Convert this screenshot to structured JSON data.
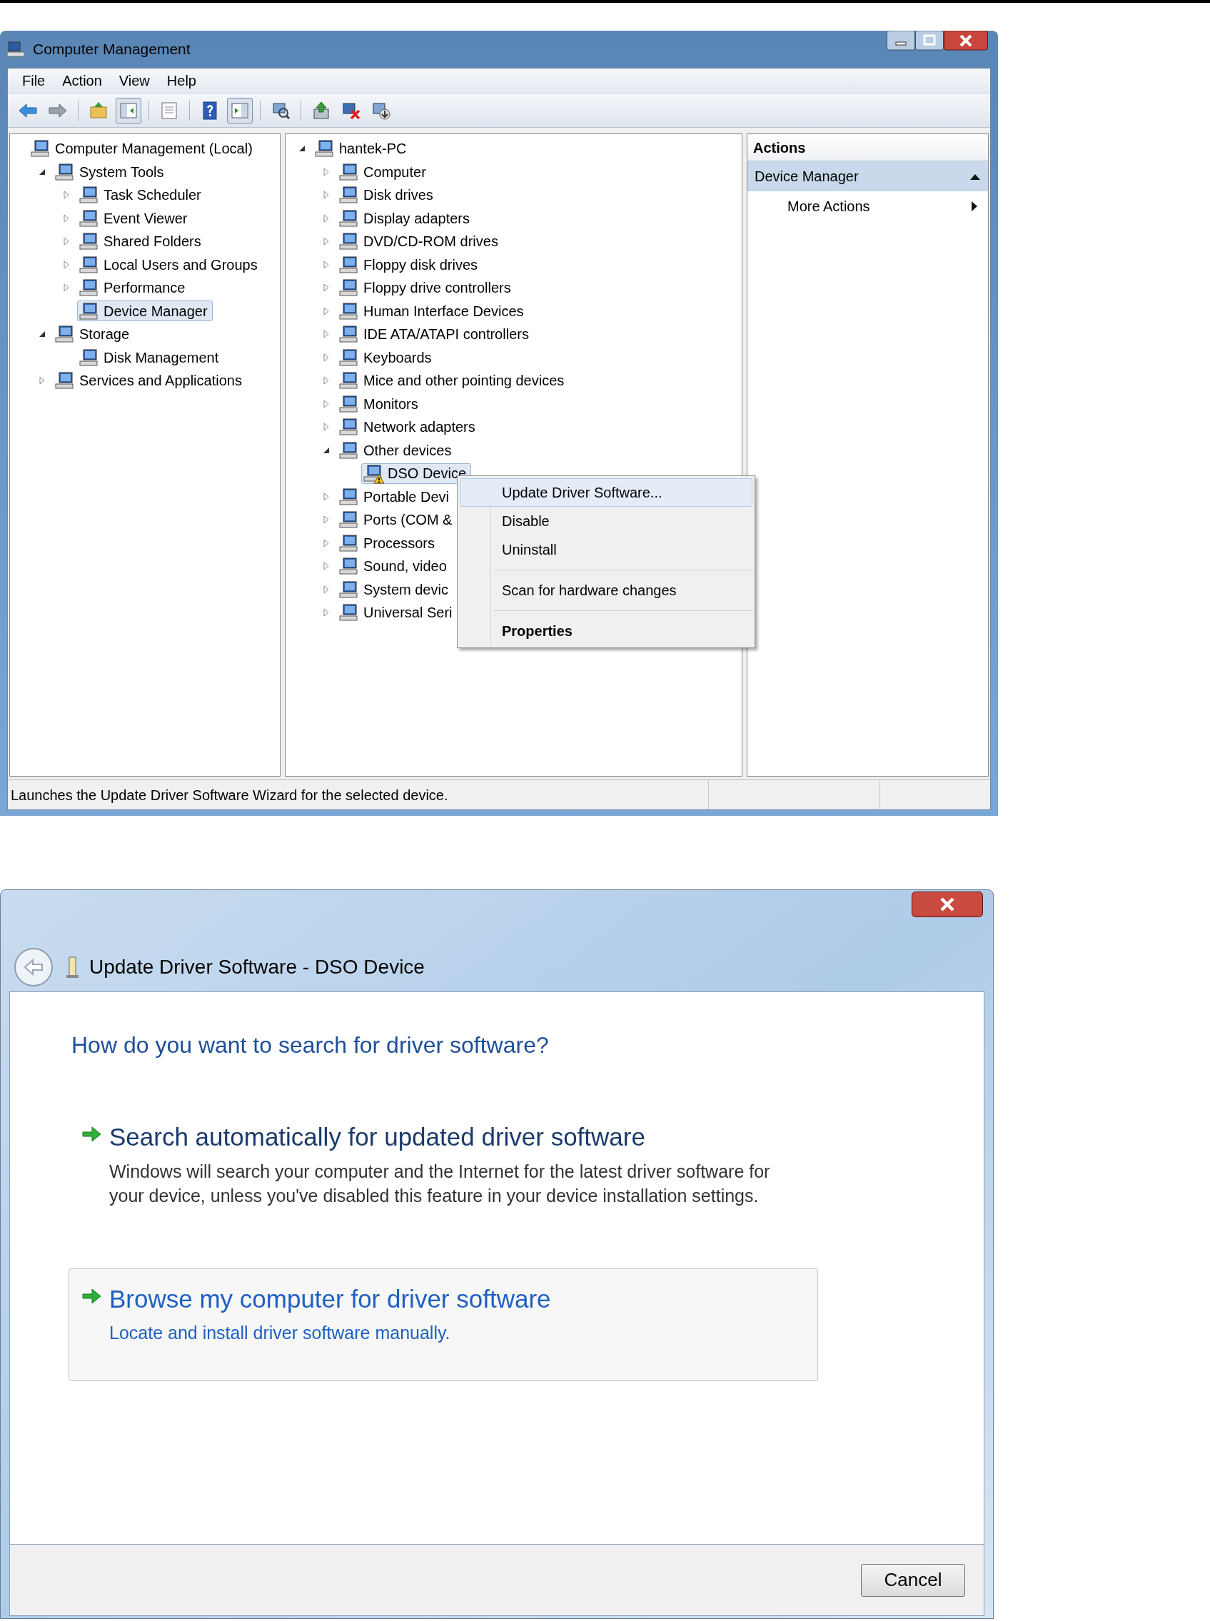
{
  "window": {
    "title": "Computer Management",
    "menu": [
      "File",
      "Action",
      "View",
      "Help"
    ],
    "toolbar": [
      {
        "kind": "back",
        "pressed": false
      },
      {
        "kind": "forward",
        "pressed": false
      },
      {
        "kind": "separator"
      },
      {
        "kind": "up",
        "pressed": false
      },
      {
        "kind": "tree",
        "pressed": true
      },
      {
        "kind": "separator"
      },
      {
        "kind": "list",
        "pressed": false
      },
      {
        "kind": "separator"
      },
      {
        "kind": "help",
        "pressed": false
      },
      {
        "kind": "pane",
        "pressed": true
      },
      {
        "kind": "separator"
      },
      {
        "kind": "scan",
        "pressed": false
      },
      {
        "kind": "separator"
      },
      {
        "kind": "update",
        "pressed": false
      },
      {
        "kind": "uninstall",
        "pressed": false
      },
      {
        "kind": "enable",
        "pressed": false
      }
    ]
  },
  "console_tree": [
    {
      "label": "Computer Management (Local)",
      "selected": false,
      "children": [
        {
          "label": "System Tools",
          "selected": false,
          "expanded": true,
          "children": [
            {
              "label": "Task Scheduler",
              "selected": false,
              "expanded": false
            },
            {
              "label": "Event Viewer",
              "selected": false,
              "expanded": false
            },
            {
              "label": "Shared Folders",
              "selected": false,
              "expanded": false
            },
            {
              "label": "Local Users and Groups",
              "selected": false,
              "expanded": false
            },
            {
              "label": "Performance",
              "selected": false,
              "expanded": false
            },
            {
              "label": "Device Manager",
              "selected": true
            }
          ]
        },
        {
          "label": "Storage",
          "selected": false,
          "expanded": true,
          "children": [
            {
              "label": "Disk Management",
              "selected": false
            }
          ]
        },
        {
          "label": "Services and Applications",
          "selected": false,
          "expanded": false
        }
      ]
    }
  ],
  "device_tree": [
    {
      "label": "hantek-PC",
      "selected": false,
      "expanded": true,
      "children": [
        {
          "label": "Computer",
          "selected": false,
          "expanded": false
        },
        {
          "label": "Disk drives",
          "selected": false,
          "expanded": false
        },
        {
          "label": "Display adapters",
          "selected": false,
          "expanded": false
        },
        {
          "label": "DVD/CD-ROM drives",
          "selected": false,
          "expanded": false
        },
        {
          "label": "Floppy disk drives",
          "selected": false,
          "expanded": false
        },
        {
          "label": "Floppy drive controllers",
          "selected": false,
          "expanded": false
        },
        {
          "label": "Human Interface Devices",
          "selected": false,
          "expanded": false
        },
        {
          "label": "IDE ATA/ATAPI controllers",
          "selected": false,
          "expanded": false
        },
        {
          "label": "Keyboards",
          "selected": false,
          "expanded": false
        },
        {
          "label": "Mice and other pointing devices",
          "selected": false,
          "expanded": false
        },
        {
          "label": "Monitors",
          "selected": false,
          "expanded": false
        },
        {
          "label": "Network adapters",
          "selected": false,
          "expanded": false
        },
        {
          "label": "Other devices",
          "selected": false,
          "expanded": true,
          "children": [
            {
              "label": "DSO Device",
              "selected": true,
              "warning": true
            }
          ]
        },
        {
          "label": "Portable Devi",
          "selected": false,
          "expanded": false
        },
        {
          "label": "Ports (COM &",
          "selected": false,
          "expanded": false
        },
        {
          "label": "Processors",
          "selected": false,
          "expanded": false
        },
        {
          "label": "Sound, video",
          "selected": false,
          "expanded": false
        },
        {
          "label": "System devic",
          "selected": false,
          "expanded": false
        },
        {
          "label": "Universal Seri",
          "selected": false,
          "expanded": false
        }
      ]
    }
  ],
  "context_menu": [
    {
      "kind": "item",
      "label": "Update Driver Software...",
      "selected": true,
      "bold": false
    },
    {
      "kind": "item",
      "label": "Disable",
      "selected": false,
      "bold": false
    },
    {
      "kind": "item",
      "label": "Uninstall",
      "selected": false,
      "bold": false
    },
    {
      "kind": "separator"
    },
    {
      "kind": "item",
      "label": "Scan for hardware changes",
      "selected": false,
      "bold": false
    },
    {
      "kind": "separator"
    },
    {
      "kind": "item",
      "label": "Properties",
      "selected": false,
      "bold": true
    }
  ],
  "actions": {
    "title": "Actions",
    "items": [
      {
        "kind": "section",
        "label": "Device Manager",
        "expanded": true
      },
      {
        "kind": "submenu",
        "label": "More Actions"
      }
    ]
  },
  "status_bar": "Launches the Update Driver Software Wizard for the selected device.",
  "dialog": {
    "title": "Update Driver Software - DSO Device",
    "heading": "How do you want to search for driver software?",
    "options": [
      {
        "title": "Search automatically for updated driver software",
        "description": "Windows will search your computer and the Internet for the latest driver software for your device, unless you've disabled this feature in your device installation settings.",
        "hovered": false
      },
      {
        "title": "Browse my computer for driver software",
        "description": "Locate and install driver software manually.",
        "hovered": true
      }
    ],
    "cancel": "Cancel"
  }
}
